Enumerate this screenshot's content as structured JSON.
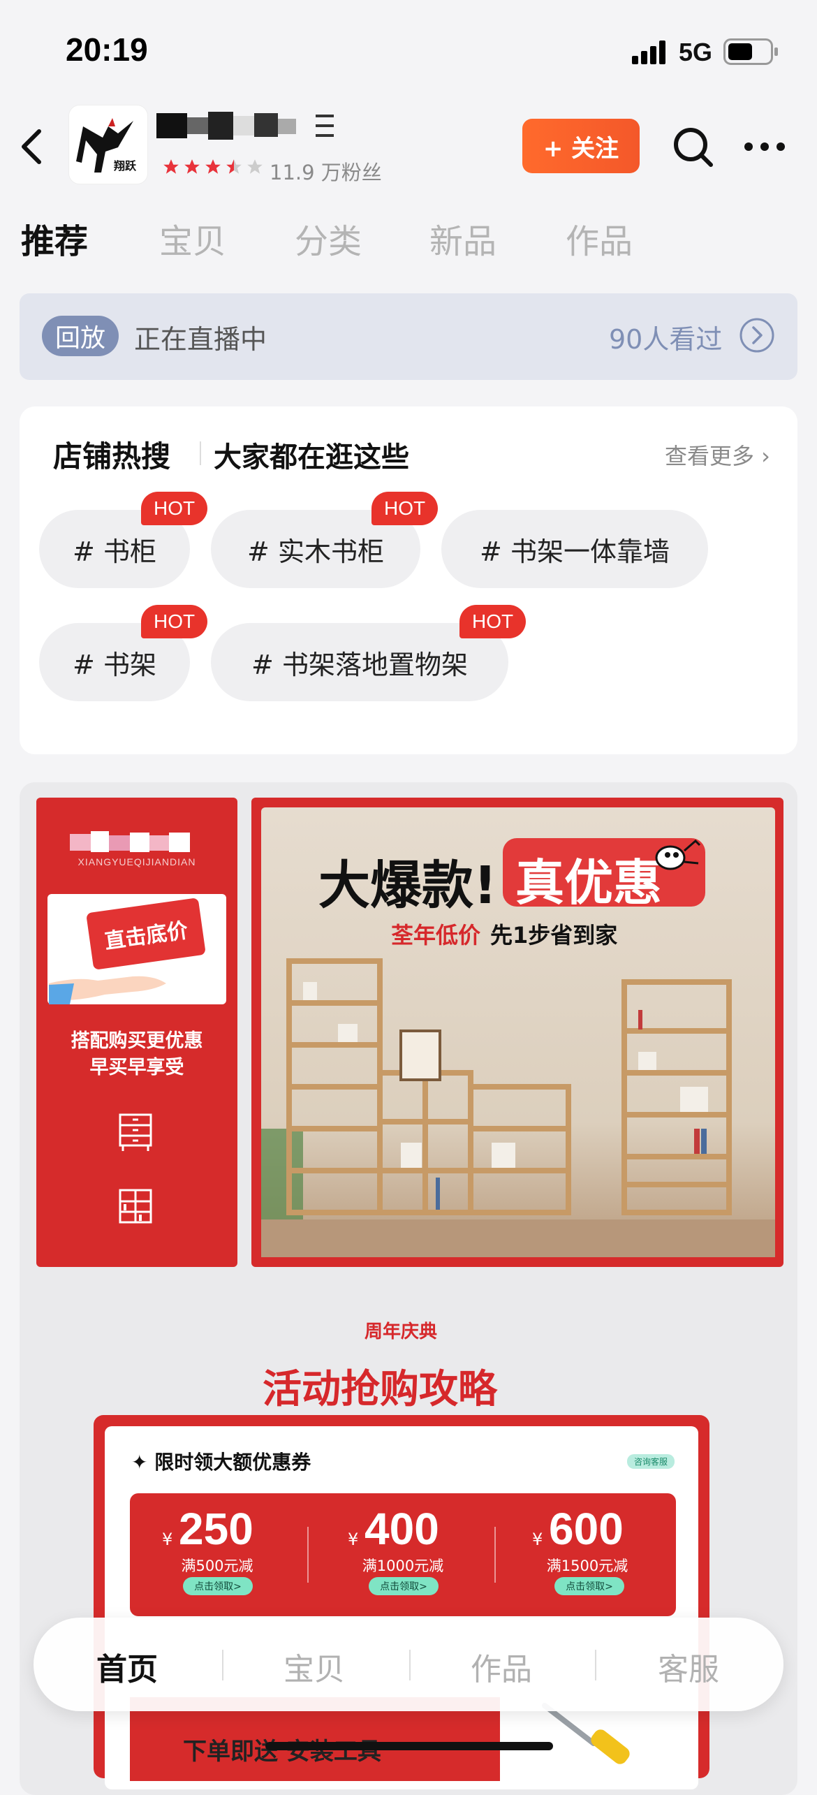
{
  "status_bar": {
    "time": "20:19",
    "network": "5G"
  },
  "header": {
    "fans_count": "11.9 万粉丝",
    "rating_stars": 3.5,
    "follow_label": "+ 关注"
  },
  "tabs": [
    "推荐",
    "宝贝",
    "分类",
    "新品",
    "作品"
  ],
  "live": {
    "badge": "回放",
    "status": "正在直播中",
    "viewers": "90人看过"
  },
  "hot_search": {
    "title": "店铺热搜",
    "subtitle": "大家都在逛这些",
    "more": "查看更多 ›",
    "hot_badge": "HOT",
    "chips": [
      "# 书柜",
      "# 实木书柜",
      "# 书架一体靠墙",
      "# 书架",
      "# 书架落地置物架"
    ]
  },
  "promo": {
    "brand_sub": "XIANGYUEQIJIANDIAN",
    "tag": "直击底价",
    "text_1": "搭配购买更优惠",
    "text_2": "早买早享受",
    "headline_1": "大爆款!",
    "headline_2": "真优惠",
    "subline_red": "荃年低价",
    "subline_black": "先1步省到家"
  },
  "activity": {
    "anniv_label": "周年庆典",
    "title": "活动抢购攻略",
    "coupon_title": "✦ 限时领大额优惠券",
    "service_badge": "咨询客服",
    "coupons": [
      {
        "yen": "¥",
        "amount": "250",
        "cond": "满500元减",
        "btn": "点击领取>"
      },
      {
        "yen": "¥",
        "amount": "400",
        "cond": "满1000元减",
        "btn": "点击领取>"
      },
      {
        "yen": "¥",
        "amount": "600",
        "cond": "满1500元减",
        "btn": "点击领取>"
      }
    ],
    "gift_text": "下单即送 安装工具"
  },
  "bottom_nav": [
    "首页",
    "宝贝",
    "作品",
    "客服"
  ],
  "colors": {
    "accent_red": "#d62b2b",
    "follow_orange": "#f4582a",
    "live_blue": "#7f8fb5"
  }
}
